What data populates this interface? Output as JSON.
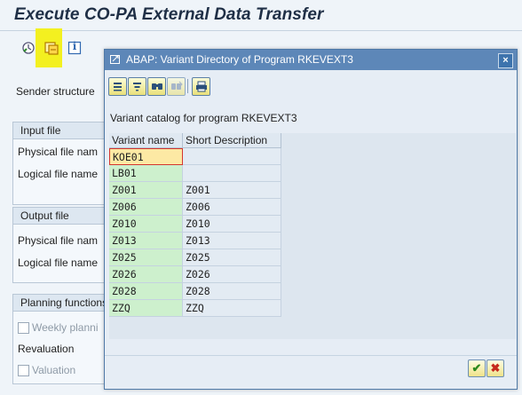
{
  "window": {
    "title": "Execute CO-PA External Data Transfer"
  },
  "toolbar": {
    "execute_icon": "execute-clock-icon",
    "variant_icon": "get-variant-icon",
    "info_icon": "info-icon",
    "info_label": "i"
  },
  "background": {
    "sender_structure_label": "Sender structure",
    "input_file": {
      "header": "Input file",
      "physical": "Physical file name",
      "logical": "Logical file name"
    },
    "output_file": {
      "header": "Output file",
      "physical": "Physical file name",
      "logical": "Logical file name"
    },
    "planning": {
      "header": "Planning functions",
      "weekly": "Weekly planning",
      "revaluation": "Revaluation",
      "valuation": "Valuation"
    }
  },
  "dialog": {
    "title": "ABAP: Variant Directory of Program RKEVEXT3",
    "close_label": "×",
    "catalog_text": "Variant catalog for program RKEVEXT3",
    "columns": [
      "Variant name",
      "Short Description"
    ],
    "rows": [
      {
        "name": "KOE01",
        "desc": ""
      },
      {
        "name": "LB01",
        "desc": ""
      },
      {
        "name": "Z001",
        "desc": "Z001"
      },
      {
        "name": "Z006",
        "desc": "Z006"
      },
      {
        "name": "Z010",
        "desc": "Z010"
      },
      {
        "name": "Z013",
        "desc": "Z013"
      },
      {
        "name": "Z025",
        "desc": "Z025"
      },
      {
        "name": "Z026",
        "desc": "Z026"
      },
      {
        "name": "Z028",
        "desc": "Z028"
      },
      {
        "name": "ZZQ",
        "desc": "ZZQ"
      }
    ],
    "selected_row": 0,
    "ok_label": "✔",
    "cancel_label": "✖",
    "tools": [
      "align-left-icon",
      "filter-icon",
      "find-icon",
      "find-next-icon",
      "print-icon"
    ]
  },
  "colors": {
    "highlight": "#f3f020",
    "dialog_titlebar": "#5d87b8",
    "variant_cell": "#cdf0cd",
    "selected_cell": "#fde9a4"
  }
}
